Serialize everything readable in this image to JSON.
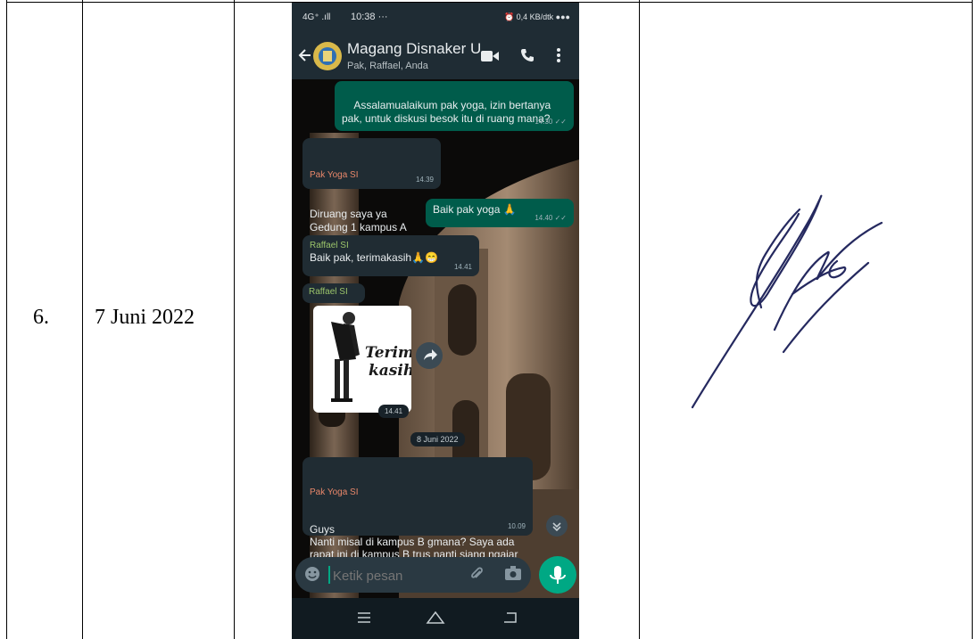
{
  "row": {
    "number": "6.",
    "date": "7 Juni 2022"
  },
  "phone": {
    "status": {
      "left": "4G⁺ .ıll",
      "time": "10:38 ···",
      "right": "⏰ 0,4 KB/dtk ●●●"
    },
    "chat": {
      "title": "Magang Disnaker U...",
      "subtitle": "Pak, Raffael, Anda"
    },
    "messages": [
      {
        "text": "Assalamualaikum pak yoga, izin bertanya pak, untuk diskusi besok itu di ruang mana?",
        "time": "14.30 ✓✓"
      },
      {
        "sender": "Pak Yoga SI",
        "text": "Diruang saya ya\nGedung 1 kampus A",
        "time": "14.39"
      },
      {
        "text": "Baik pak yoga 🙏",
        "time": "14.40 ✓✓"
      },
      {
        "sender": "Raffael SI",
        "text": "Baik pak, terimakasih🙏😁",
        "time": "14.41"
      },
      {
        "sender": "Raffael SI",
        "sticker_text": "Terima kasih",
        "time": "14.41"
      },
      {
        "sender": "Pak Yoga SI",
        "text": "Guys\nNanti misal di kampus B gmana? Saya ada rapat ini di kampus B trus nanti siang ngajar di kampus B ternyata",
        "time": "10.09"
      }
    ],
    "date_separator": "8 Juni 2022",
    "input_placeholder": "Ketik pesan",
    "icons": [
      "back-arrow-icon",
      "group-avatar",
      "video-call-icon",
      "phone-icon",
      "more-vert-icon",
      "forward-icon",
      "scroll-down-icon",
      "emoji-icon",
      "attach-icon",
      "camera-icon",
      "mic-icon",
      "menu-nav-icon",
      "home-nav-icon",
      "back-nav-icon"
    ]
  },
  "colors": {
    "header": "#1f2c34",
    "outgoing": "#005c4b",
    "incoming": "#202c33",
    "mic": "#00a884",
    "pak_yoga_name": "#e8876a",
    "raffael_name": "#9bc46a",
    "signature_ink": "#25295f"
  }
}
